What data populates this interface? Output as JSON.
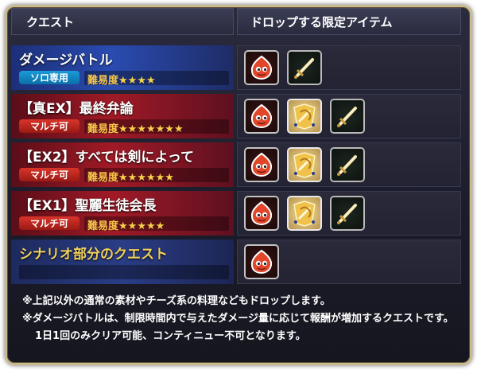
{
  "header": {
    "quest_col": "クエスト",
    "drop_col": "ドロップする限定アイテム"
  },
  "difficulty_label": "難易度",
  "quests": [
    {
      "title": "ダメージバトル",
      "badge": "ソロ専用",
      "badge_type": "solo",
      "stars": "★★★★",
      "star_count": 4,
      "theme": "blue",
      "drops": [
        "red-blob-icon",
        "sword-icon"
      ]
    },
    {
      "title": "【真EX】最終弁論",
      "badge": "マルチ可",
      "badge_type": "multi",
      "stars": "★★★★★★★",
      "star_count": 7,
      "theme": "red",
      "drops": [
        "red-blob-icon",
        "golden-medal-icon",
        "sword-icon"
      ]
    },
    {
      "title": "【EX2】すべては剣によって",
      "badge": "マルチ可",
      "badge_type": "multi",
      "stars": "★★★★★★",
      "star_count": 6,
      "theme": "red",
      "drops": [
        "red-blob-icon",
        "golden-medal-icon",
        "sword-icon"
      ]
    },
    {
      "title": "【EX1】聖麗生徒会長",
      "badge": "マルチ可",
      "badge_type": "multi",
      "stars": "★★★★★",
      "star_count": 5,
      "theme": "red",
      "drops": [
        "red-blob-icon",
        "golden-medal-icon",
        "sword-icon"
      ]
    },
    {
      "title": "シナリオ部分のクエスト",
      "badge": "",
      "badge_type": "none",
      "stars": "",
      "star_count": 0,
      "theme": "plain",
      "drops": [
        "red-blob-icon"
      ]
    }
  ],
  "notes": [
    "※上記以外の通常の素材やチーズ系の料理などもドロップします。",
    "※ダメージバトルは、制限時間内で与えたダメージ量に応じて報酬が増加するクエストです。",
    "1日1回のみクリア可能、コンティニュー不可となります。"
  ],
  "colors": {
    "frame": "#c9b98e",
    "star": "#f4d24a",
    "solo_badge": "#1a9bd8",
    "multi_badge": "#d9352a",
    "gold_title": "#f2d25a"
  }
}
